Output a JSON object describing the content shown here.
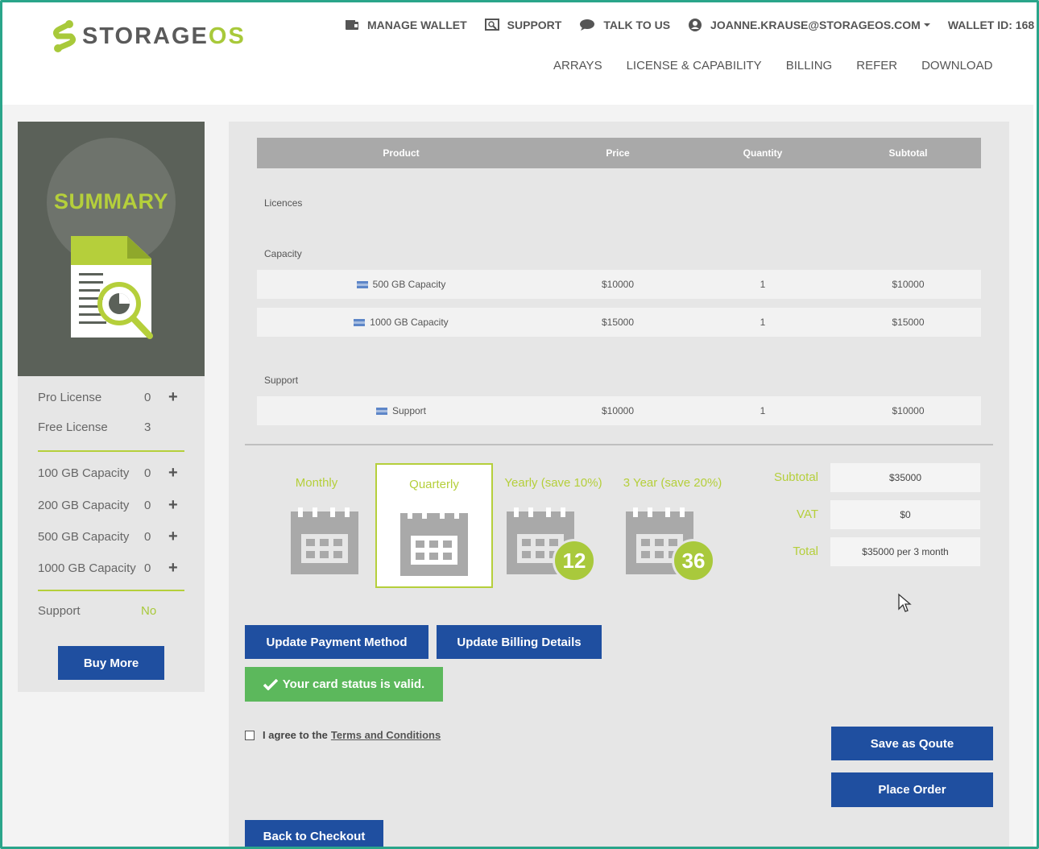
{
  "brand": {
    "name_main": "STORAGE",
    "name_accent": "OS",
    "accent_color": "#a8c93a",
    "primary_color": "#1f4fa0"
  },
  "topnav": {
    "manage_wallet": "MANAGE WALLET",
    "support": "SUPPORT",
    "talk_to_us": "TALK TO US",
    "user_email": "JOANNE.KRAUSE@STORAGEOS.COM",
    "wallet_id": "WALLET ID: 168"
  },
  "mainnav": {
    "arrays": "ARRAYS",
    "license_capability": "LICENSE & CAPABILITY",
    "billing": "BILLING",
    "refer": "REFER",
    "download": "DOWNLOAD"
  },
  "sidebar": {
    "title": "SUMMARY",
    "items": [
      {
        "label": "Pro License",
        "count": "0"
      },
      {
        "label": "Free License",
        "count": "3"
      },
      {
        "label": "100 GB Capacity",
        "count": "0"
      },
      {
        "label": "200 GB Capacity",
        "count": "0"
      },
      {
        "label": "500 GB Capacity",
        "count": "0"
      },
      {
        "label": "1000 GB Capacity",
        "count": "0"
      }
    ],
    "support_label": "Support",
    "support_value": "No",
    "buy_more": "Buy More"
  },
  "table": {
    "headers": [
      "Product",
      "Price",
      "Quantity",
      "Subtotal"
    ],
    "sections": {
      "licences": "Licences",
      "capacity": "Capacity",
      "support": "Support"
    },
    "capacity_rows": [
      {
        "product": "500 GB Capacity",
        "price": "$10000",
        "quantity": "1",
        "subtotal": "$10000"
      },
      {
        "product": "1000 GB Capacity",
        "price": "$15000",
        "quantity": "1",
        "subtotal": "$15000"
      }
    ],
    "support_rows": [
      {
        "product": "Support",
        "price": "$10000",
        "quantity": "1",
        "subtotal": "$10000"
      }
    ]
  },
  "plans": [
    {
      "label": "Monthly",
      "badge": ""
    },
    {
      "label": "Quarterly",
      "badge": "",
      "selected": true
    },
    {
      "label": "Yearly (save 10%)",
      "badge": "12"
    },
    {
      "label": "3 Year (save 20%)",
      "badge": "36"
    }
  ],
  "totals": {
    "subtotal_label": "Subtotal",
    "subtotal_value": "$35000",
    "vat_label": "VAT",
    "vat_value": "$0",
    "total_label": "Total",
    "total_value": "$35000 per 3 month"
  },
  "actions": {
    "update_payment": "Update Payment Method",
    "update_billing": "Update Billing Details",
    "card_status": "Your card status is valid.",
    "agree_prefix": "I agree to the",
    "terms_link": "Terms and Conditions",
    "save_quote": "Save as Qoute",
    "place_order": "Place Order",
    "back_to_checkout": "Back to Checkout"
  }
}
